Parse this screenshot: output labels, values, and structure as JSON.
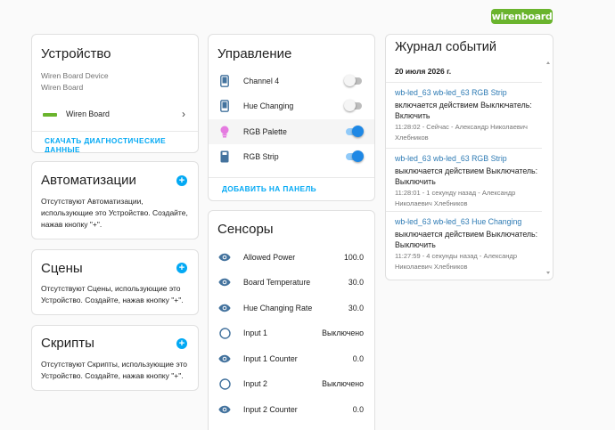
{
  "logo": "wirenboard",
  "device": {
    "title": "Устройство",
    "model": "Wiren Board Device",
    "manufacturer": "Wiren Board",
    "link_label": "Wiren Board",
    "diag_button": "СКАЧАТЬ ДИАГНОСТИЧЕСКИЕ ДАННЫЕ"
  },
  "automations": {
    "title": "Автоматизации",
    "text": "Отсутствуют Автоматизации, использующие это Устройство. Создайте, нажав кнопку \"+\"."
  },
  "scenes": {
    "title": "Сцены",
    "text": "Отсутствуют Сцены, использующие это Устройство. Создайте, нажав кнопку \"+\"."
  },
  "scripts": {
    "title": "Скрипты",
    "text": "Отсутствуют Скрипты, использующие это Устройство. Создайте, нажав кнопку \"+\"."
  },
  "controls": {
    "title": "Управление",
    "items": [
      {
        "label": "Channel 4",
        "icon": "phone-icon",
        "state": false
      },
      {
        "label": "Hue Changing",
        "icon": "phone-icon",
        "state": false
      },
      {
        "label": "RGB Palette",
        "icon": "bulb-icon",
        "state": true
      },
      {
        "label": "RGB Strip",
        "icon": "remote-icon",
        "state": true
      }
    ],
    "add_button": "ДОБАВИТЬ НА ПАНЕЛЬ"
  },
  "sensors": {
    "title": "Сенсоры",
    "items": [
      {
        "label": "Allowed Power",
        "value": "100.0",
        "icon": "eye-icon"
      },
      {
        "label": "Board Temperature",
        "value": "30.0",
        "icon": "eye-icon"
      },
      {
        "label": "Hue Changing Rate",
        "value": "30.0",
        "icon": "eye-icon"
      },
      {
        "label": "Input 1",
        "value": "Выключено",
        "icon": "circle-icon"
      },
      {
        "label": "Input 1 Counter",
        "value": "0.0",
        "icon": "eye-icon"
      },
      {
        "label": "Input 2",
        "value": "Выключено",
        "icon": "circle-icon"
      },
      {
        "label": "Input 2 Counter",
        "value": "0.0",
        "icon": "eye-icon"
      }
    ]
  },
  "log": {
    "title": "Журнал событий",
    "date": "20 июля 2026 г.",
    "entries": [
      {
        "entity": "wb-led_63 wb-led_63 RGB Strip",
        "message": "включается действием Выключатель: Включить",
        "meta": "11:28:02 - Сейчас - Александр Николаевич Хлебников"
      },
      {
        "entity": "wb-led_63 wb-led_63 RGB Strip",
        "message": "выключается действием Выключатель: Выключить",
        "meta": "11:28:01 - 1 секунду назад - Александр Николаевич Хлебников"
      },
      {
        "entity": "wb-led_63 wb-led_63 Hue Changing",
        "message": "выключается действием Выключатель: Выключить",
        "meta": "11:27:59 - 4 секунды назад - Александр Николаевич Хлебников"
      }
    ]
  },
  "colors": {
    "accent": "#03a9f4",
    "toggle_on": "#1e88e5",
    "brand": "#6ab42d",
    "link": "#2e7bb4"
  }
}
